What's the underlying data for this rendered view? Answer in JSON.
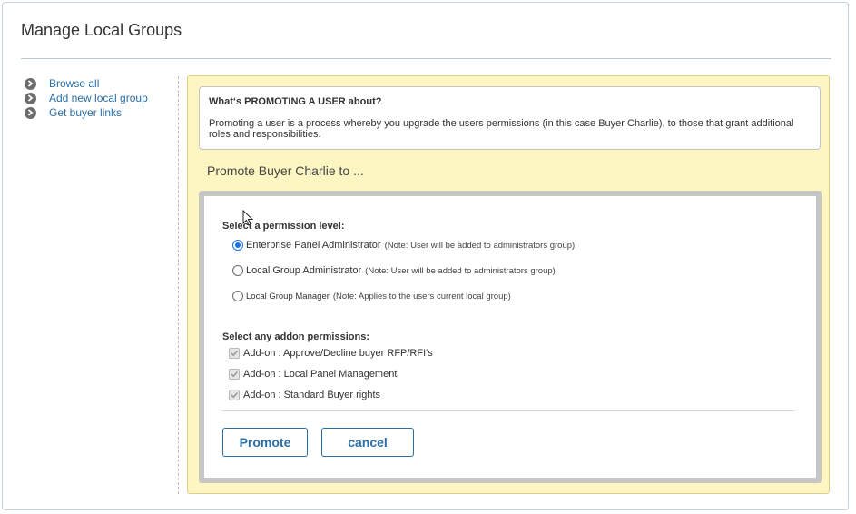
{
  "page": {
    "title": "Manage Local Groups"
  },
  "sidebar": {
    "items": [
      {
        "label": "Browse all",
        "icon": "chevron-right-circle-icon"
      },
      {
        "label": "Add new local group",
        "icon": "chevron-right-circle-icon"
      },
      {
        "label": "Get buyer links",
        "icon": "chevron-right-circle-icon"
      }
    ]
  },
  "info": {
    "heading": "What‘s PROMOTING A USER about?",
    "text": "Promoting a user is a process whereby you upgrade the users permissions (in this case Buyer Charlie), to those that grant additional roles and responsibilities."
  },
  "promote_heading": "Promote Buyer Charlie to ...",
  "permission_level": {
    "label": "Select a permission level:",
    "options": [
      {
        "label": "Enterprise Panel Administrator",
        "note": "(Note: User will be added to administrators group)",
        "selected": true
      },
      {
        "label": "Local Group Administrator",
        "note": "(Note: User will be added to administrators group)",
        "selected": false
      },
      {
        "label": "Local Group Manager",
        "note": "(Note: Applies to the users current local group)",
        "selected": false
      }
    ]
  },
  "addons": {
    "label": "Select any addon permissions:",
    "options": [
      {
        "label": "Add-on : Approve/Decline buyer RFP/RFI's",
        "checked": true,
        "disabled": true
      },
      {
        "label": "Add-on : Local Panel Management",
        "checked": true,
        "disabled": true
      },
      {
        "label": "Add-on : Standard Buyer rights",
        "checked": true,
        "disabled": true
      }
    ]
  },
  "buttons": {
    "promote": "Promote",
    "cancel": "cancel"
  },
  "colors": {
    "link": "#2a6ea6",
    "panel_background": "#fdf6c3",
    "frame": "#c6c6c6",
    "radio_selected": "#1a73e8"
  }
}
